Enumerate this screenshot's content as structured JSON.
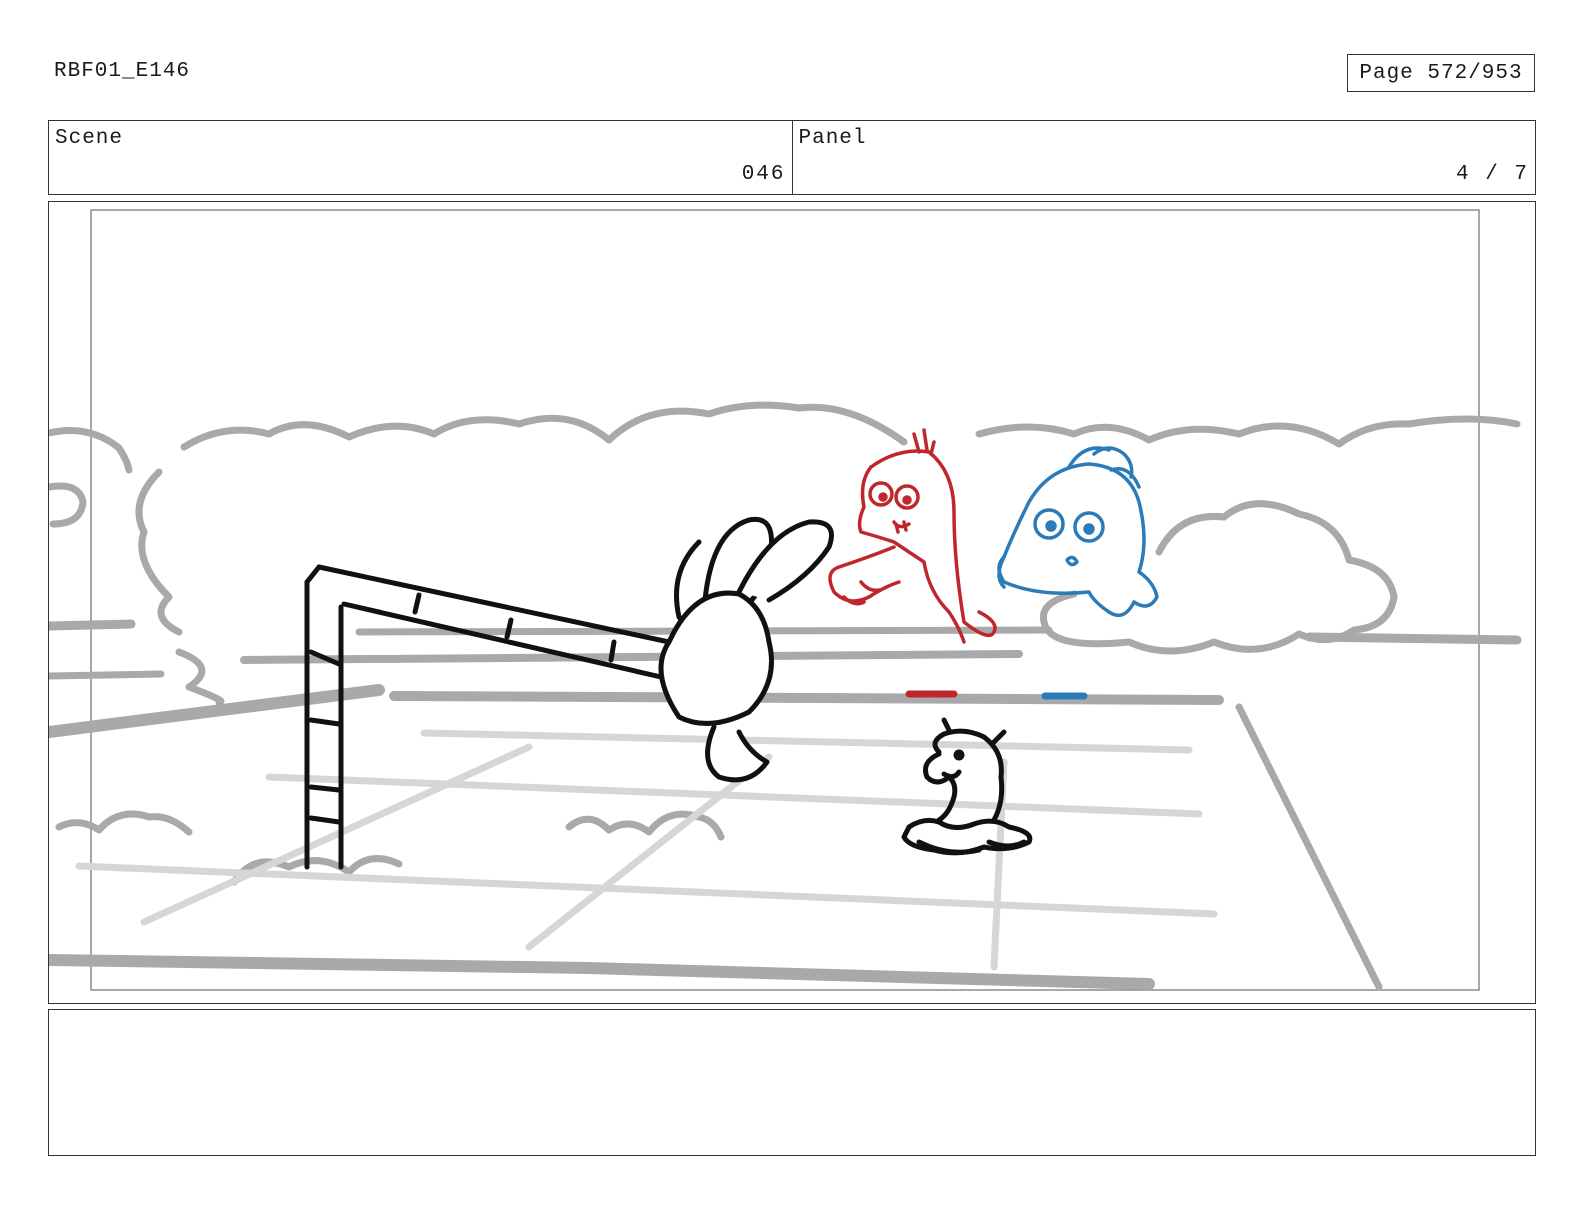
{
  "document": {
    "id": "RBF01_E146",
    "page": "Page 572/953"
  },
  "header": {
    "scene_label": "Scene",
    "scene_value": "046",
    "panel_label": "Panel",
    "panel_value": "4 / 7"
  },
  "artwork": {
    "colors": {
      "line": "#111111",
      "background_gray": "#a9a9a9",
      "floor_gray": "#d6d6d6",
      "red_character": "#c0272d",
      "blue_character": "#2b7bb9"
    }
  },
  "notes": {
    "text": ""
  }
}
